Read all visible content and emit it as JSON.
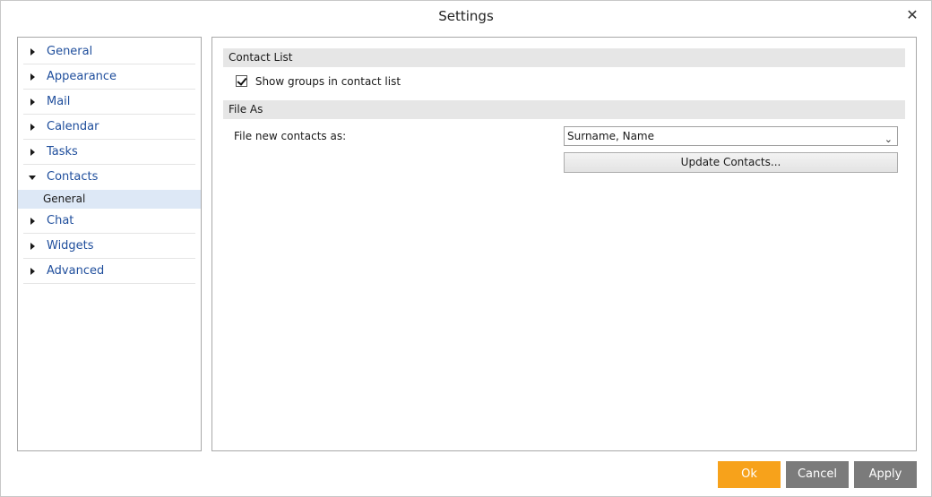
{
  "window": {
    "title": "Settings",
    "close_glyph": "✕"
  },
  "sidebar": {
    "items": [
      {
        "label": "General",
        "expanded": false
      },
      {
        "label": "Appearance",
        "expanded": false
      },
      {
        "label": "Mail",
        "expanded": false
      },
      {
        "label": "Calendar",
        "expanded": false
      },
      {
        "label": "Tasks",
        "expanded": false
      },
      {
        "label": "Contacts",
        "expanded": true,
        "children": [
          {
            "label": "General",
            "selected": true
          }
        ]
      },
      {
        "label": "Chat",
        "expanded": false
      },
      {
        "label": "Widgets",
        "expanded": false
      },
      {
        "label": "Advanced",
        "expanded": false
      }
    ]
  },
  "content": {
    "contact_list": {
      "header": "Contact List",
      "show_groups_label": "Show groups in contact list",
      "show_groups_checked": true
    },
    "file_as": {
      "header": "File As",
      "field_label": "File new contacts as:",
      "selected_value": "Surname, Name",
      "update_button": "Update Contacts..."
    }
  },
  "footer": {
    "ok": "Ok",
    "cancel": "Cancel",
    "apply": "Apply"
  },
  "colors": {
    "accent_ok": "#f7a21b",
    "button_gray": "#7b7b7b",
    "nav_link": "#1f4e9c",
    "selection": "#dde8f6"
  },
  "icons": {
    "close": "close-icon",
    "collapsed": "caret-right-icon",
    "expanded": "caret-down-icon",
    "dropdown": "chevron-down-icon"
  }
}
